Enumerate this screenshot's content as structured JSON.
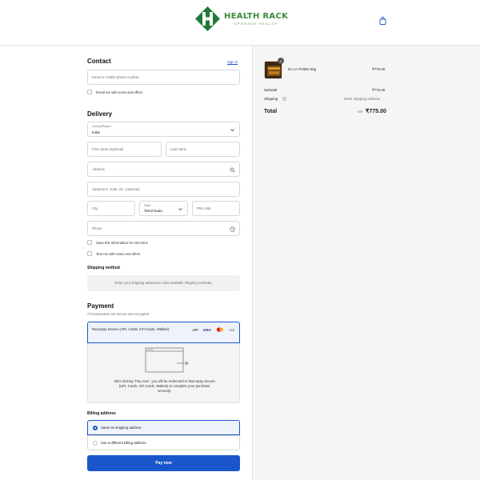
{
  "brand": {
    "name": "HEALTH RACK",
    "tagline": "UPGRADE HEALTH"
  },
  "contact": {
    "title": "Contact",
    "sign_in": "Sign in",
    "email_placeholder": "Email or mobile phone number",
    "news_checkbox": "Email me with news and offers"
  },
  "delivery": {
    "title": "Delivery",
    "country_label": "Country/Region",
    "country_value": "India",
    "first_name_placeholder": "First name (optional)",
    "last_name_placeholder": "Last name",
    "address_placeholder": "Address",
    "apartment_placeholder": "Apartment, suite, etc. (optional)",
    "city_placeholder": "City",
    "state_label": "State",
    "state_value": "Tamil Nadu",
    "pin_placeholder": "PIN code",
    "phone_placeholder": "Phone",
    "save_checkbox": "Save this information for next time",
    "text_checkbox": "Text me with news and offers"
  },
  "shipping_method": {
    "title": "Shipping method",
    "message": "Enter your shipping address to view available shipping methods."
  },
  "payment": {
    "title": "Payment",
    "subtitle": "All transactions are secure and encrypted.",
    "option_label": "Razorpay Secure (UPI, Cards, Int'l Cards, Wallets)",
    "logos": {
      "upi": "UPI",
      "visa": "VISA",
      "more": "+16"
    },
    "redirect_message": "After clicking “Pay now”, you will be redirected to Razorpay Secure (UPI, Cards, Int'l Cards, Wallets) to complete your purchase securely."
  },
  "billing": {
    "title": "Billing address",
    "same_option": "Same as shipping address",
    "different_option": "Use a different billing address"
  },
  "pay_button": "Pay now",
  "summary": {
    "item_name": "M.A.C Pellets 50g",
    "item_qty": "1",
    "item_price": "₹775.00",
    "subtotal_label": "Subtotal",
    "subtotal_value": "₹775.00",
    "shipping_label": "Shipping",
    "shipping_value": "Enter shipping address",
    "total_label": "Total",
    "currency": "INR",
    "total_value": "₹775.00"
  },
  "colors": {
    "accent": "#1a56c9",
    "brand_green": "#3a8c3a",
    "panel_bg": "#f5f5f5"
  }
}
